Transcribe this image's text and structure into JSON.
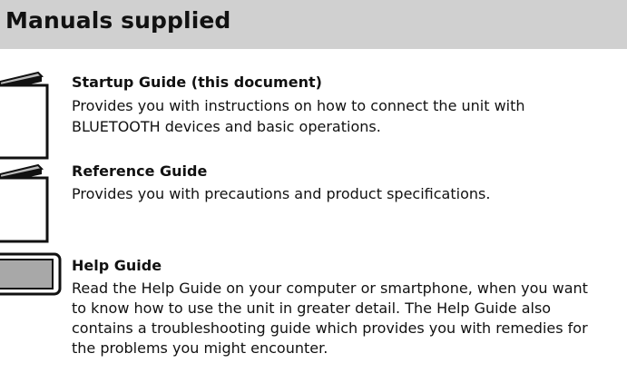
{
  "section": {
    "title": "Manuals supplied"
  },
  "items": [
    {
      "title": "Startup Guide (this document)",
      "description_lines": [
        "Provides you with instructions on how to connect the unit with",
        "BLUETOOTH devices and basic operations."
      ],
      "icon": "booklet-icon"
    },
    {
      "title": "Reference Guide",
      "description_lines": [
        "Provides you with precautions and product specifications."
      ],
      "icon": "booklet-icon"
    },
    {
      "title": "Help Guide",
      "description_lines": [
        "Read the Help Guide on your computer or smartphone, when you want",
        "to know how to use the unit in greater detail. The Help Guide also",
        "contains a troubleshooting guide which provides you with remedies for",
        "the problems you might encounter."
      ],
      "icon": "screen-icon"
    }
  ],
  "colors": {
    "header_background": "#d0d0d0",
    "booklet_cover_fill": "#ffffff",
    "screen_fill": "#a8a8a8",
    "outline": "#111111"
  }
}
